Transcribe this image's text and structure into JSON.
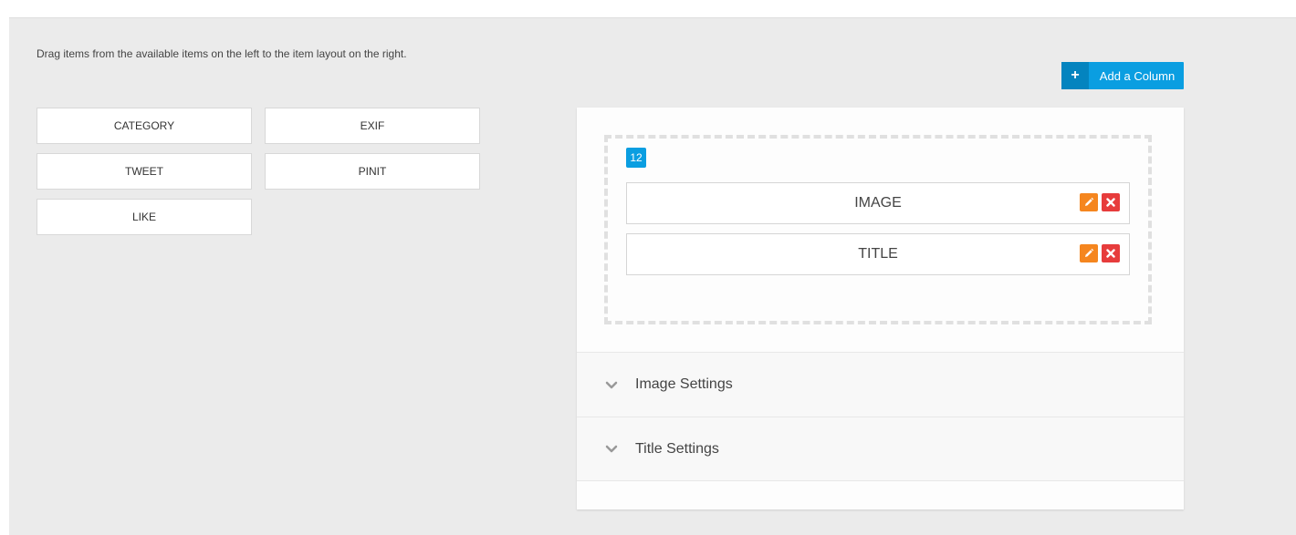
{
  "instructions": "Drag items from the available items on the left to the item layout on the right.",
  "add_column": {
    "label": "Add a Column",
    "icon": "plus-icon"
  },
  "available_items": [
    {
      "label": "CATEGORY"
    },
    {
      "label": "EXIF"
    },
    {
      "label": "TWEET"
    },
    {
      "label": "PINIT"
    },
    {
      "label": "LIKE"
    }
  ],
  "layout": {
    "column_size": "12",
    "items": [
      {
        "label": "IMAGE"
      },
      {
        "label": "TITLE"
      }
    ]
  },
  "settings": [
    {
      "title": "Image Settings",
      "icon": "chevron-down-icon"
    },
    {
      "title": "Title Settings",
      "icon": "chevron-down-icon"
    }
  ],
  "colors": {
    "accent": "#0a9ee1",
    "accent_dark": "#0484bf",
    "edit": "#f5861f",
    "remove": "#e73c3c"
  }
}
